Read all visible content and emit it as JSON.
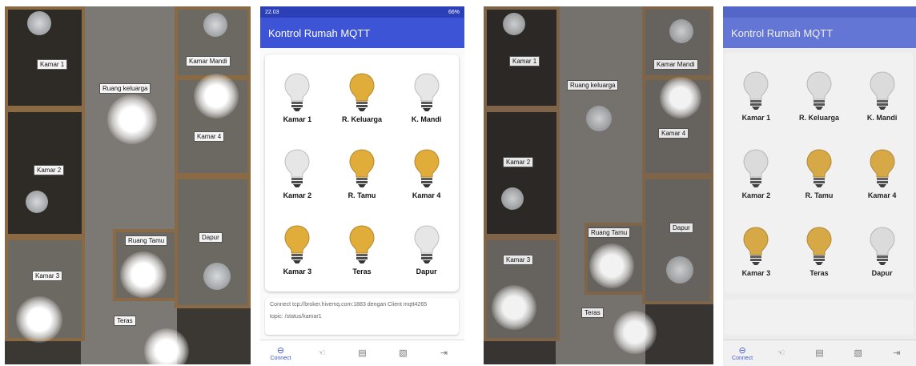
{
  "left": {
    "photo_labels": [
      "Kamar 1",
      "Ruang keluarga",
      "Kamar Mandi",
      "Kamar 4",
      "Kamar 2",
      "Ruang Tamu",
      "Dapur",
      "Kamar 3",
      "Teras"
    ],
    "phone": {
      "status_time": "22.03",
      "status_right": "66%",
      "app_title": "Kontrol Rumah MQTT",
      "lamps": [
        {
          "label": "Kamar 1",
          "on": false
        },
        {
          "label": "R. Keluarga",
          "on": true
        },
        {
          "label": "K. Mandi",
          "on": false
        },
        {
          "label": "Kamar 2",
          "on": false
        },
        {
          "label": "R. Tamu",
          "on": true
        },
        {
          "label": "Kamar 4",
          "on": true
        },
        {
          "label": "Kamar 3",
          "on": true
        },
        {
          "label": "Teras",
          "on": true
        },
        {
          "label": "Dapur",
          "on": false
        }
      ],
      "log_line1": "Connect tcp://broker.hivemq.com:1883 dengan Client mqtt4265",
      "log_line2": "topic: /status/kamar1",
      "nav": [
        {
          "label": "Connect",
          "icon": "link-icon",
          "glyph": "⊖"
        },
        {
          "label": "",
          "icon": "touch-icon",
          "glyph": "☜"
        },
        {
          "label": "",
          "icon": "message-icon",
          "glyph": "▤"
        },
        {
          "label": "",
          "icon": "message-off-icon",
          "glyph": "▧"
        },
        {
          "label": "",
          "icon": "logout-icon",
          "glyph": "⇥"
        }
      ]
    }
  },
  "right": {
    "photo_labels": [
      "Kamar 1",
      "Ruang keluarga",
      "Kamar Mandi",
      "Kamar 4",
      "Kamar 2",
      "Ruang Tamu",
      "Dapur",
      "Kamar 3",
      "Teras"
    ],
    "phone": {
      "app_title": "Kontrol Rumah MQTT",
      "lamps": [
        {
          "label": "Kamar 1",
          "on": false
        },
        {
          "label": "R. Keluarga",
          "on": false
        },
        {
          "label": "K. Mandi",
          "on": false
        },
        {
          "label": "Kamar 2",
          "on": false
        },
        {
          "label": "R. Tamu",
          "on": true
        },
        {
          "label": "Kamar 4",
          "on": true
        },
        {
          "label": "Kamar 3",
          "on": true
        },
        {
          "label": "Teras",
          "on": true
        },
        {
          "label": "Dapur",
          "on": false
        }
      ],
      "log_line1": "",
      "log_line2": "",
      "log_line3": "",
      "nav": [
        {
          "label": "Connect",
          "icon": "link-icon",
          "glyph": "⊖"
        },
        {
          "label": "",
          "icon": "touch-icon",
          "glyph": "☜"
        },
        {
          "label": "",
          "icon": "message-icon",
          "glyph": "▤"
        },
        {
          "label": "",
          "icon": "message-off-icon",
          "glyph": "▧"
        },
        {
          "label": "",
          "icon": "logout-icon",
          "glyph": "⇥"
        }
      ]
    }
  },
  "colors": {
    "bulb_on": "#e0ad3a",
    "bulb_off": "#e6e6e6",
    "appbar": "#3d54d6",
    "statusbar": "#2b3fb8"
  }
}
